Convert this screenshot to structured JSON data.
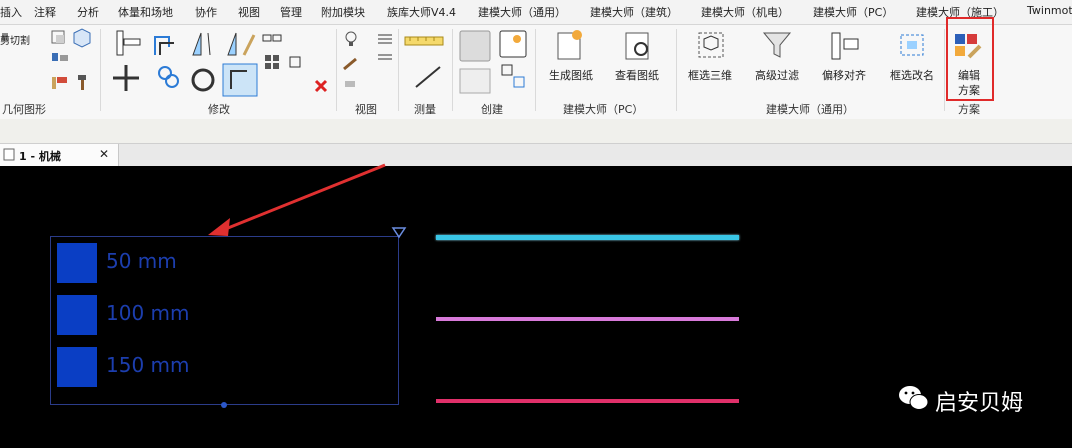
{
  "menubar": {
    "items": [
      "插入",
      "注释",
      "分析",
      "体量和场地",
      "协作",
      "视图",
      "管理",
      "附加模块",
      "族库大师V4.4",
      "建模大师（通用）",
      "建模大师（建筑）",
      "建模大师（机电）",
      "建模大师（PC）",
      "建模大师（施工）",
      "Twinmoti"
    ]
  },
  "ribbon": {
    "geometry": {
      "cut_label": "剪切割",
      "label": "几何图形"
    },
    "modify": {
      "label": "修改"
    },
    "view": {
      "label": "视图"
    },
    "measure": {
      "label": "测量"
    },
    "create": {
      "label": "创建"
    },
    "pc": {
      "label": "建模大师（PC）",
      "generate_label": "生成图纸",
      "view_label": "查看图纸"
    },
    "general": {
      "label": "建模大师（通用）",
      "select3d_label": "框选三维",
      "filter_label": "高级过滤",
      "offset_label": "偏移对齐",
      "rename_label": "框选改名"
    },
    "scheme": {
      "label": "方案",
      "edit_label_line1": "编辑",
      "edit_label_line2": "方案"
    }
  },
  "view_tab": {
    "title": "1 - 机械",
    "close": "✕"
  },
  "legend": {
    "items": [
      "50 mm",
      "100 mm",
      "150 mm"
    ],
    "swatch_color": "#0a3ec4"
  },
  "pipes": {
    "colors": [
      "#39c6e6",
      "#d77ad9",
      "#e0306a"
    ]
  },
  "watermark": {
    "text": "启安贝姆"
  },
  "colors": {
    "highlight": "#e02a2a",
    "arrow": "#e03030"
  }
}
